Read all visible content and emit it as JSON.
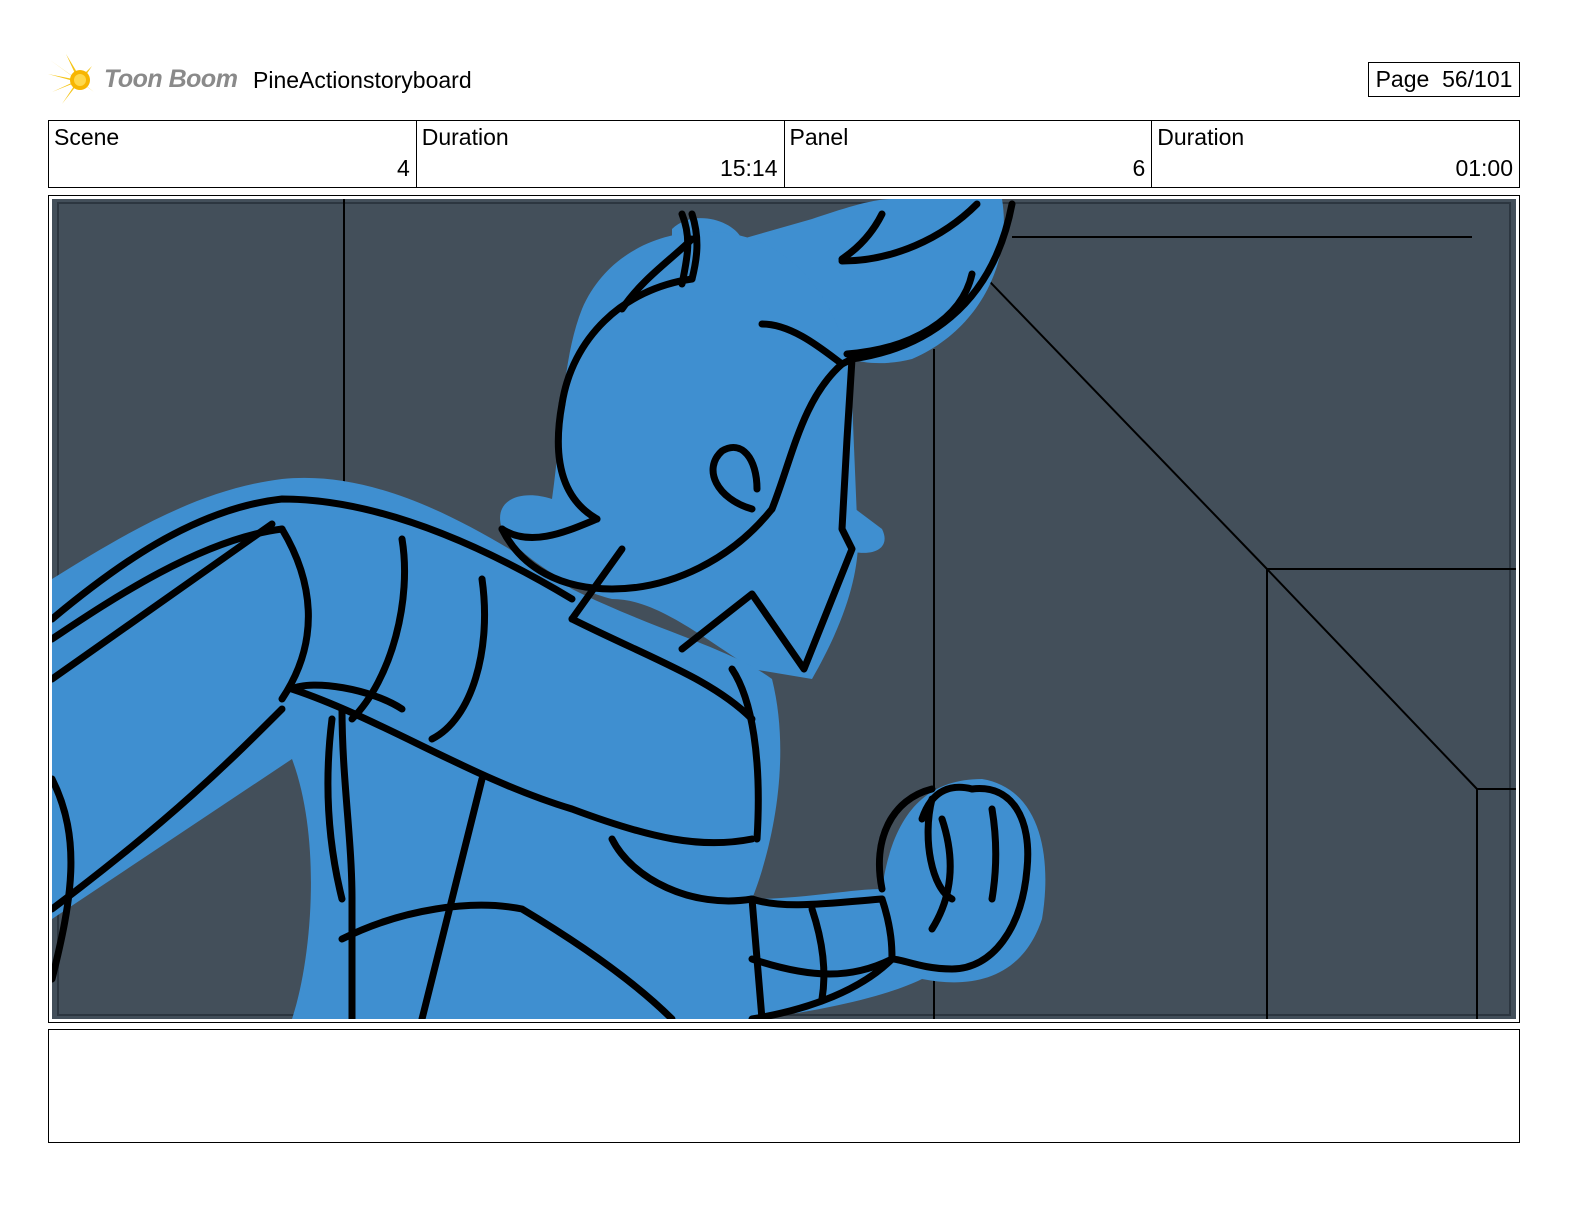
{
  "header": {
    "logo_text": "Toon Boom",
    "project_title": "PineActionstoryboard",
    "page_label": "Page",
    "page_number": "56/101"
  },
  "info": {
    "scene_label": "Scene",
    "scene_value": "4",
    "scene_duration_label": "Duration",
    "scene_duration_value": "15:14",
    "panel_label": "Panel",
    "panel_value": "6",
    "panel_duration_label": "Duration",
    "panel_duration_value": "01:00"
  },
  "panel": {
    "background_color": "#434f5a",
    "character_color": "#3f8fd0",
    "line_color": "#000000"
  },
  "notes": {
    "text": ""
  }
}
